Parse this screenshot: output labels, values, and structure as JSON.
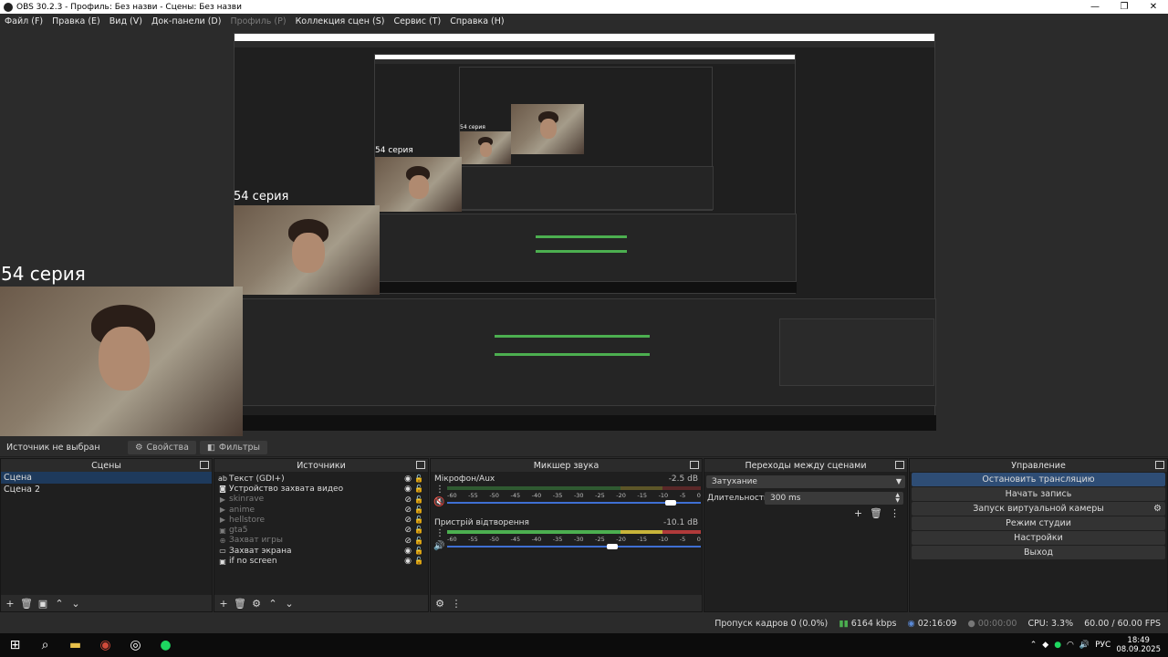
{
  "window": {
    "title": "OBS 30.2.3 - Профиль: Без назви - Сцены: Без назви",
    "min": "—",
    "max": "❐",
    "close": "✕"
  },
  "menu": {
    "items": [
      "Файл (F)",
      "Правка (E)",
      "Вид (V)",
      "Док-панели (D)",
      "Профиль (P)",
      "Коллекция сцен (S)",
      "Сервис (T)",
      "Справка (H)"
    ],
    "disabled_index": 4
  },
  "preview": {
    "caption_large": "54 серия",
    "caption_mid": "54 серия",
    "caption_small": "54 серия",
    "caption_tiny": "54 серия"
  },
  "source_toolbar": {
    "no_source": "Источник не выбран",
    "properties": "Свойства",
    "filters": "Фильтры"
  },
  "scenes": {
    "title": "Сцены",
    "items": [
      "Сцена",
      "Сцена 2"
    ],
    "active_index": 0
  },
  "sources": {
    "title": "Источники",
    "items": [
      {
        "label": "Текст (GDI+)",
        "icon": "text-icon",
        "visible": true
      },
      {
        "label": "Устройство захвата видео",
        "icon": "camera-icon",
        "visible": true
      },
      {
        "label": "skinrave",
        "icon": "media-icon",
        "visible": false
      },
      {
        "label": "anime",
        "icon": "media-icon",
        "visible": false
      },
      {
        "label": "hellstore",
        "icon": "media-icon",
        "visible": false
      },
      {
        "label": "gta5",
        "icon": "image-icon",
        "visible": false
      },
      {
        "label": "Захват игры",
        "icon": "game-icon",
        "visible": false
      },
      {
        "label": "Захват экрана",
        "icon": "monitor-icon",
        "visible": true
      },
      {
        "label": "if no screen",
        "icon": "image-icon",
        "visible": true
      }
    ]
  },
  "mixer": {
    "title": "Микшер звука",
    "scale": [
      "-60",
      "-55",
      "-50",
      "-45",
      "-40",
      "-35",
      "-30",
      "-25",
      "-20",
      "-15",
      "-10",
      "-5",
      "0"
    ],
    "channels": [
      {
        "name": "Мікрофон/Aux",
        "db": "-2.5 dB",
        "muted": true,
        "volume": 0.88
      },
      {
        "name": "Пристрій відтворення",
        "db": "-10.1 dB",
        "muted": false,
        "volume": 0.65
      }
    ]
  },
  "transitions": {
    "title": "Переходы между сценами",
    "type": "Затухание",
    "duration_label": "Длительность",
    "duration_value": "300 ms"
  },
  "controls": {
    "title": "Управление",
    "buttons": [
      "Остановить трансляцию",
      "Начать запись",
      "Запуск виртуальной камеры",
      "Режим студии",
      "Настройки",
      "Выход"
    ],
    "active_index": 0
  },
  "status": {
    "dropped": "Пропуск кадров 0 (0.0%)",
    "bitrate": "6164 kbps",
    "stream_time": "02:16:09",
    "rec_time": "00:00:00",
    "cpu": "CPU: 3.3%",
    "fps": "60.00 / 60.00 FPS"
  },
  "taskbar": {
    "lang": "РУС",
    "time": "18:49",
    "date": "08.09.2025"
  },
  "colors": {
    "accent": "#2e4d75",
    "meter_green": "#4caf50",
    "meter_yellow": "#c9b53a",
    "meter_red": "#b03a3a",
    "slider": "#3f6fd3"
  }
}
